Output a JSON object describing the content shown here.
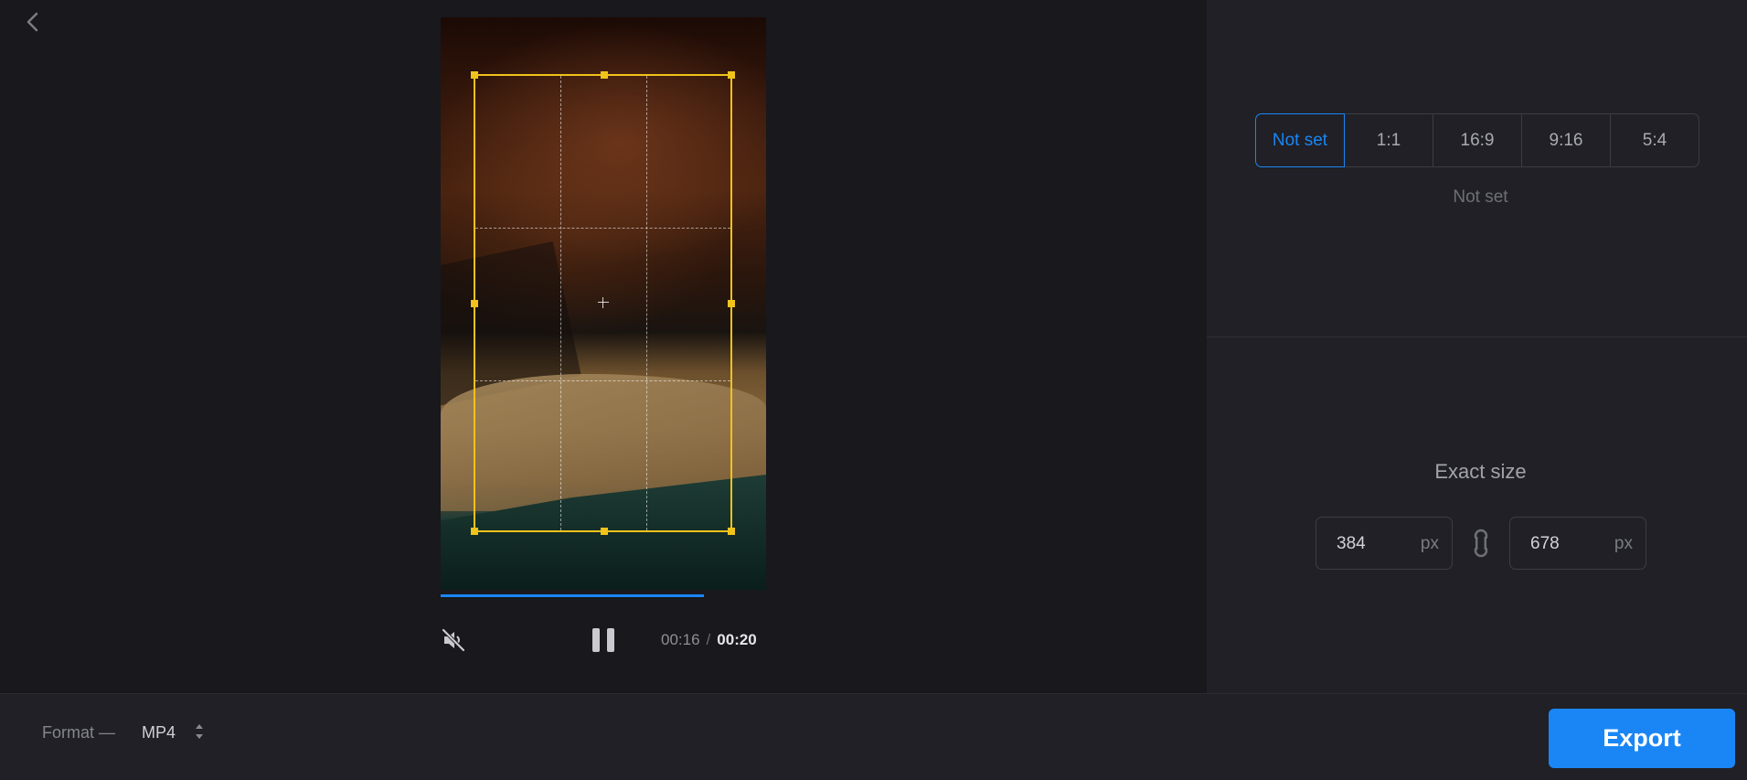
{
  "nav": {
    "back_icon": "chevron-left-icon"
  },
  "player": {
    "progress": 0.81,
    "current_time": "00:16",
    "separator": "/",
    "total_time": "00:20",
    "mute_icon": "volume-muted-icon",
    "pause_icon": "pause-icon"
  },
  "aspect_ratio": {
    "options": [
      "Not set",
      "1:1",
      "16:9",
      "9:16",
      "5:4"
    ],
    "selected": "Not set",
    "status": "Not set"
  },
  "exact_size": {
    "title": "Exact size",
    "width": "384",
    "height": "678",
    "unit": "px",
    "link_icon": "link-icon"
  },
  "footer": {
    "format_label": "Format —",
    "format_value": "MP4",
    "export_label": "Export"
  },
  "colors": {
    "accent": "#1a86f5",
    "crop_handle": "#f0c21c",
    "background": "#18181d",
    "panel": "#202026"
  }
}
